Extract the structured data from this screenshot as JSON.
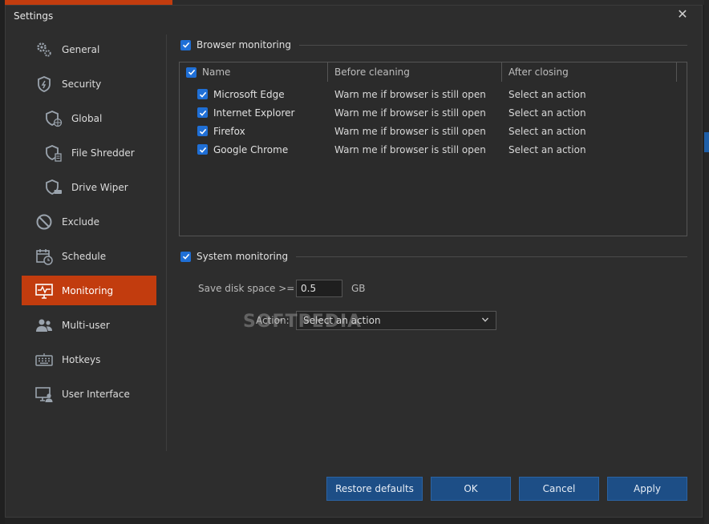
{
  "window": {
    "title": "Settings"
  },
  "sidebar": {
    "items": [
      {
        "label": "General",
        "icon": "gears-icon",
        "sub": false,
        "active": false
      },
      {
        "label": "Security",
        "icon": "shield-icon",
        "sub": false,
        "active": false
      },
      {
        "label": "Global",
        "icon": "shield-globe-icon",
        "sub": true,
        "active": false
      },
      {
        "label": "File Shredder",
        "icon": "shield-file-icon",
        "sub": true,
        "active": false
      },
      {
        "label": "Drive Wiper",
        "icon": "shield-drive-icon",
        "sub": true,
        "active": false
      },
      {
        "label": "Exclude",
        "icon": "no-entry-icon",
        "sub": false,
        "active": false
      },
      {
        "label": "Schedule",
        "icon": "calendar-clock-icon",
        "sub": false,
        "active": false
      },
      {
        "label": "Monitoring",
        "icon": "monitor-pulse-icon",
        "sub": false,
        "active": true
      },
      {
        "label": "Multi-user",
        "icon": "users-icon",
        "sub": false,
        "active": false
      },
      {
        "label": "Hotkeys",
        "icon": "keyboard-icon",
        "sub": false,
        "active": false
      },
      {
        "label": "User Interface",
        "icon": "monitor-user-icon",
        "sub": false,
        "active": false
      }
    ]
  },
  "browser_monitoring": {
    "label": "Browser monitoring",
    "checked": true,
    "columns": {
      "name": "Name",
      "before": "Before cleaning",
      "after": "After closing"
    },
    "rows": [
      {
        "name": "Microsoft Edge",
        "before": "Warn me if browser is still open",
        "after": "Select an action",
        "checked": true
      },
      {
        "name": "Internet Explorer",
        "before": "Warn me if browser is still open",
        "after": "Select an action",
        "checked": true
      },
      {
        "name": "Firefox",
        "before": "Warn me if browser is still open",
        "after": "Select an action",
        "checked": true
      },
      {
        "name": "Google Chrome",
        "before": "Warn me if browser is still open",
        "after": "Select an action",
        "checked": true
      }
    ]
  },
  "system_monitoring": {
    "label": "System monitoring",
    "checked": true,
    "disk_label": "Save disk space >=",
    "disk_value": "0.5",
    "disk_unit": "GB",
    "action_label": "Action:",
    "action_value": "Select an action"
  },
  "watermark": "SOFTPEDIA",
  "buttons": {
    "restore": "Restore defaults",
    "ok": "OK",
    "cancel": "Cancel",
    "apply": "Apply"
  },
  "colors": {
    "accent": "#c23c0e",
    "checkbox": "#1f6fd6",
    "button": "#1d4e86"
  }
}
